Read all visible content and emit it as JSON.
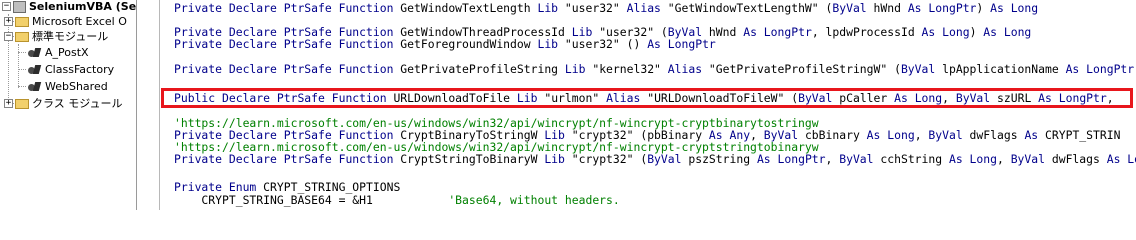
{
  "explorer": {
    "items": [
      {
        "label": "SeleniumVBA (Sel",
        "expand": "−"
      },
      {
        "label": "Microsoft Excel O",
        "expand": "+"
      },
      {
        "label": "標準モジュール",
        "expand": "−"
      },
      {
        "label": "A_PostX"
      },
      {
        "label": "ClassFactory"
      },
      {
        "label": "WebShared"
      },
      {
        "label": "クラス モジュール",
        "expand": "+"
      }
    ]
  },
  "code_lines": [
    [
      {
        "k": 1,
        "t": "Private Declare PtrSafe Function"
      },
      {
        "t": " GetWindowTextLength "
      },
      {
        "k": 1,
        "t": "Lib"
      },
      {
        "t": " \"user32\" "
      },
      {
        "k": 1,
        "t": "Alias"
      },
      {
        "t": " \"GetWindowTextLengthW\" ("
      },
      {
        "k": 1,
        "t": "ByVal"
      },
      {
        "t": " hWnd "
      },
      {
        "k": 1,
        "t": "As LongPtr"
      },
      {
        "t": ") "
      },
      {
        "k": 1,
        "t": "As Long"
      }
    ],
    [
      {
        "k": 1,
        "t": "Private Declare PtrSafe Function"
      },
      {
        "t": " GetWindowThreadProcessId "
      },
      {
        "k": 1,
        "t": "Lib"
      },
      {
        "t": " \"user32\" ("
      },
      {
        "k": 1,
        "t": "ByVal"
      },
      {
        "t": " hWnd "
      },
      {
        "k": 1,
        "t": "As LongPtr"
      },
      {
        "t": ", lpdwProcessId "
      },
      {
        "k": 1,
        "t": "As Long"
      },
      {
        "t": ") "
      },
      {
        "k": 1,
        "t": "As Long"
      }
    ],
    [
      {
        "k": 1,
        "t": "Private Declare PtrSafe Function"
      },
      {
        "t": " GetForegroundWindow "
      },
      {
        "k": 1,
        "t": "Lib"
      },
      {
        "t": " \"user32\" () "
      },
      {
        "k": 1,
        "t": "As LongPtr"
      }
    ],
    [
      {
        "k": 1,
        "t": "Private Declare PtrSafe Function"
      },
      {
        "t": " GetPrivateProfileString "
      },
      {
        "k": 1,
        "t": "Lib"
      },
      {
        "t": " \"kernel32\" "
      },
      {
        "k": 1,
        "t": "Alias"
      },
      {
        "t": " \"GetPrivateProfileStringW\" ("
      },
      {
        "k": 1,
        "t": "ByVal"
      },
      {
        "t": " lpApplicationName "
      },
      {
        "k": 1,
        "t": "As LongPtr"
      }
    ],
    [
      {
        "k": 1,
        "t": "Public Declare PtrSafe Function"
      },
      {
        "t": " URLDownloadToFile "
      },
      {
        "k": 1,
        "t": "Lib"
      },
      {
        "t": " \"urlmon\" "
      },
      {
        "k": 1,
        "t": "Alias"
      },
      {
        "t": " \"URLDownloadToFileW\" ("
      },
      {
        "k": 1,
        "t": "ByVal"
      },
      {
        "t": " pCaller "
      },
      {
        "k": 1,
        "t": "As Long"
      },
      {
        "t": ", "
      },
      {
        "k": 1,
        "t": "ByVal"
      },
      {
        "t": " szURL "
      },
      {
        "k": 1,
        "t": "As LongPtr"
      },
      {
        "t": ","
      }
    ],
    [
      {
        "c": 1,
        "t": "'https://learn.microsoft.com/en-us/windows/win32/api/wincrypt/nf-wincrypt-cryptbinarytostringw"
      }
    ],
    [
      {
        "k": 1,
        "t": "Private Declare PtrSafe Function"
      },
      {
        "t": " CryptBinaryToStringW "
      },
      {
        "k": 1,
        "t": "Lib"
      },
      {
        "t": " \"crypt32\" (pbBinary "
      },
      {
        "k": 1,
        "t": "As Any"
      },
      {
        "t": ", "
      },
      {
        "k": 1,
        "t": "ByVal"
      },
      {
        "t": " cbBinary "
      },
      {
        "k": 1,
        "t": "As Long"
      },
      {
        "t": ", "
      },
      {
        "k": 1,
        "t": "ByVal"
      },
      {
        "t": " dwFlags "
      },
      {
        "k": 1,
        "t": "As"
      },
      {
        "t": " CRYPT_STRIN"
      }
    ],
    [
      {
        "c": 1,
        "t": "'https://learn.microsoft.com/en-us/windows/win32/api/wincrypt/nf-wincrypt-cryptstringtobinaryw"
      }
    ],
    [
      {
        "k": 1,
        "t": "Private Declare PtrSafe Function"
      },
      {
        "t": " CryptStringToBinaryW "
      },
      {
        "k": 1,
        "t": "Lib"
      },
      {
        "t": " \"crypt32\" ("
      },
      {
        "k": 1,
        "t": "ByVal"
      },
      {
        "t": " pszString "
      },
      {
        "k": 1,
        "t": "As LongPtr"
      },
      {
        "t": ", "
      },
      {
        "k": 1,
        "t": "ByVal"
      },
      {
        "t": " cchString "
      },
      {
        "k": 1,
        "t": "As Long"
      },
      {
        "t": ", "
      },
      {
        "k": 1,
        "t": "ByVal"
      },
      {
        "t": " dwFlags "
      },
      {
        "k": 1,
        "t": "As Long"
      },
      {
        "t": ","
      }
    ],
    [
      {
        "k": 1,
        "t": "Private Enum"
      },
      {
        "t": " CRYPT_STRING_OPTIONS"
      }
    ],
    [
      {
        "t": "    CRYPT_STRING_BASE64 = &H1           "
      },
      {
        "c": 1,
        "t": "'Base64, without headers."
      }
    ]
  ],
  "colors": {
    "keyword": "#00008b",
    "comment": "#008000",
    "highlight": "#e8161c"
  }
}
